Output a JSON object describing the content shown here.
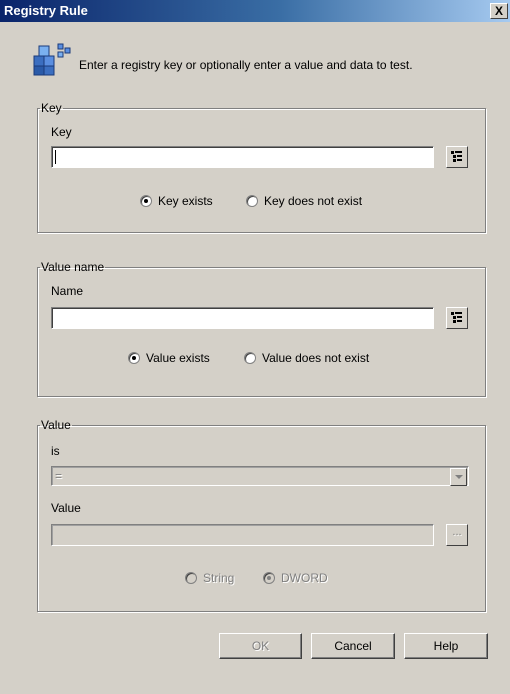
{
  "window": {
    "title": "Registry Rule",
    "close_label": "X"
  },
  "intro": {
    "text": "Enter a registry key or optionally enter a value and data to test.",
    "icon": "registry-cubes-icon"
  },
  "key_group": {
    "legend": "Key",
    "field_label": "Key",
    "value": "",
    "radio_exists": "Key exists",
    "radio_not_exists": "Key does not exist",
    "selected": "exists"
  },
  "value_name_group": {
    "legend": "Value name",
    "field_label": "Name",
    "value": "",
    "radio_exists": "Value exists",
    "radio_not_exists": "Value does not exist",
    "selected": "exists"
  },
  "value_group": {
    "legend": "Value",
    "is_label": "is",
    "operator": "=",
    "value_label": "Value",
    "value": "",
    "browse_label": "...",
    "radio_string": "String",
    "radio_dword": "DWORD",
    "selected": "DWORD"
  },
  "buttons": {
    "ok": "OK",
    "cancel": "Cancel",
    "help": "Help"
  }
}
